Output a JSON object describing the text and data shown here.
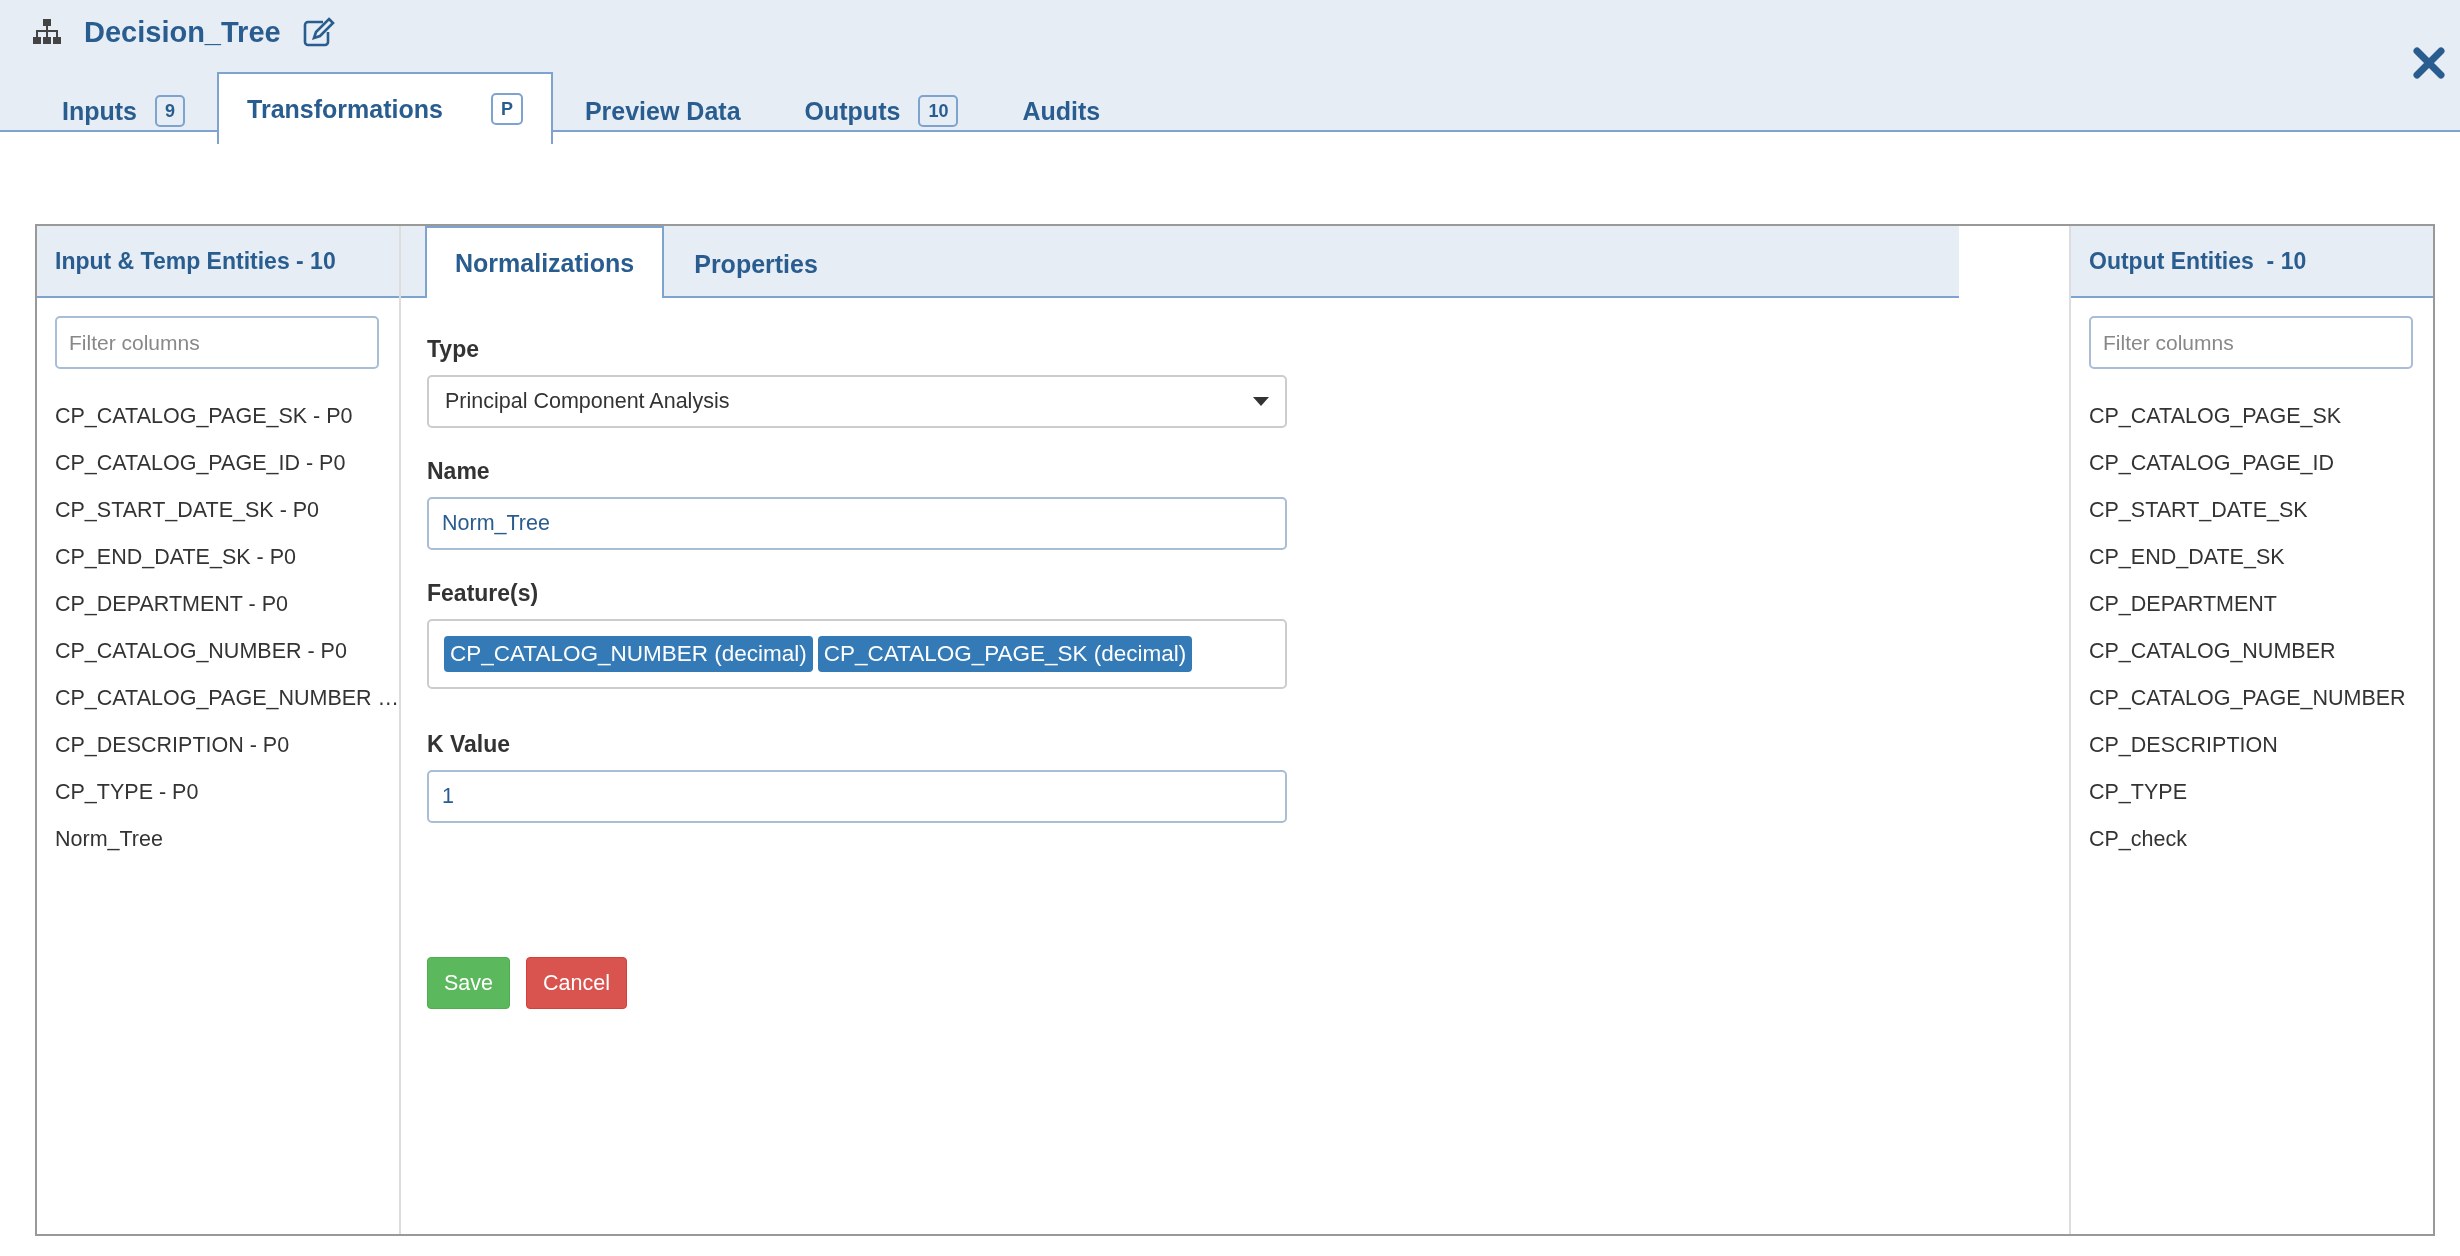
{
  "window": {
    "title": "Decision_Tree"
  },
  "tabs": [
    {
      "label": "Inputs",
      "badge": "9",
      "selected": false
    },
    {
      "label": "Transformations",
      "badge": "P",
      "selected": true
    },
    {
      "label": "Preview Data",
      "selected": false
    },
    {
      "label": "Outputs",
      "badge": "10",
      "selected": false
    },
    {
      "label": "Audits",
      "selected": false
    }
  ],
  "input_panel": {
    "title": "Input & Temp Entities - 10",
    "filter": {
      "placeholder": "Filter columns"
    },
    "items": [
      "CP_CATALOG_PAGE_SK - P0",
      "CP_CATALOG_PAGE_ID - P0",
      "CP_START_DATE_SK - P0",
      "CP_END_DATE_SK - P0",
      "CP_DEPARTMENT - P0",
      "CP_CATALOG_NUMBER - P0",
      "CP_CATALOG_PAGE_NUMBER …",
      "CP_DESCRIPTION - P0",
      "CP_TYPE - P0",
      "Norm_Tree"
    ]
  },
  "editor": {
    "tabs": [
      {
        "label": "Normalizations",
        "selected": true
      },
      {
        "label": "Properties",
        "selected": false
      }
    ],
    "form": {
      "type": {
        "label": "Type",
        "value": "Principal Component Analysis"
      },
      "name": {
        "label": "Name",
        "value": "Norm_Tree"
      },
      "features": {
        "label": "Feature(s)",
        "tags": [
          "CP_CATALOG_NUMBER (decimal)",
          "CP_CATALOG_PAGE_SK (decimal)"
        ]
      },
      "k_value": {
        "label": "K Value",
        "value": "1"
      }
    },
    "buttons": [
      {
        "label": "Save",
        "kind": "success"
      },
      {
        "label": "Cancel",
        "kind": "danger"
      }
    ]
  },
  "output_panel": {
    "title": "Output Entities  - 10",
    "filter": {
      "placeholder": "Filter columns"
    },
    "items": [
      "CP_CATALOG_PAGE_SK",
      "CP_CATALOG_PAGE_ID",
      "CP_START_DATE_SK",
      "CP_END_DATE_SK",
      "CP_DEPARTMENT",
      "CP_CATALOG_NUMBER",
      "CP_CATALOG_PAGE_NUMBER",
      "CP_DESCRIPTION",
      "CP_TYPE",
      "CP_check"
    ]
  }
}
